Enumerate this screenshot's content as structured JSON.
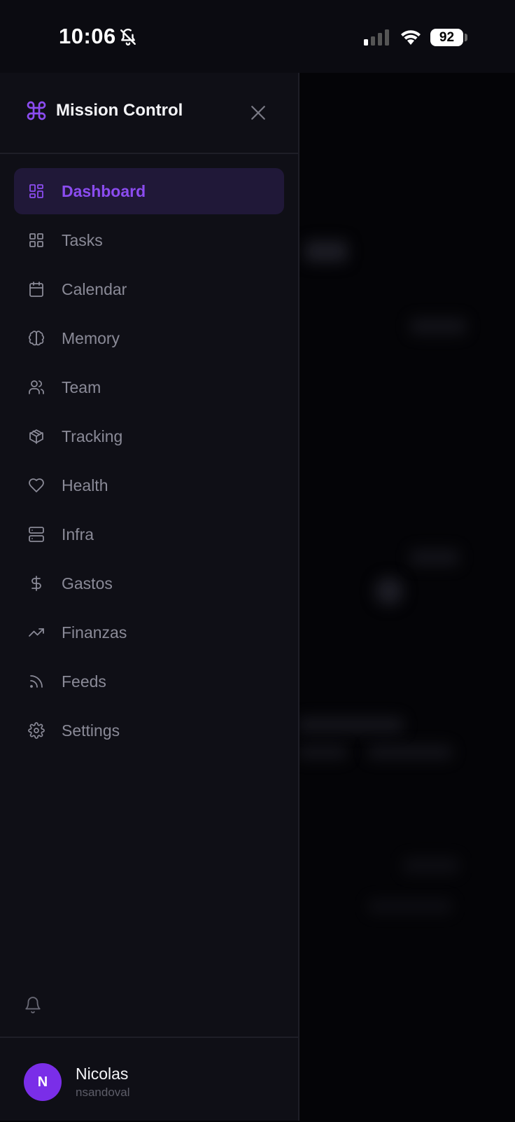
{
  "status_bar": {
    "time": "10:06",
    "battery": "92"
  },
  "sidebar": {
    "title": "Mission Control",
    "items": [
      {
        "label": "Dashboard",
        "icon": "dashboard-icon",
        "active": true
      },
      {
        "label": "Tasks",
        "icon": "grid-icon",
        "active": false
      },
      {
        "label": "Calendar",
        "icon": "calendar-icon",
        "active": false
      },
      {
        "label": "Memory",
        "icon": "brain-icon",
        "active": false
      },
      {
        "label": "Team",
        "icon": "users-icon",
        "active": false
      },
      {
        "label": "Tracking",
        "icon": "package-icon",
        "active": false
      },
      {
        "label": "Health",
        "icon": "heart-icon",
        "active": false
      },
      {
        "label": "Infra",
        "icon": "server-icon",
        "active": false
      },
      {
        "label": "Gastos",
        "icon": "dollar-icon",
        "active": false
      },
      {
        "label": "Finanzas",
        "icon": "trending-up-icon",
        "active": false
      },
      {
        "label": "Feeds",
        "icon": "rss-icon",
        "active": false
      },
      {
        "label": "Settings",
        "icon": "gear-icon",
        "active": false
      }
    ]
  },
  "user": {
    "initial": "N",
    "name": "Nicolas",
    "handle": "nsandoval"
  },
  "colors": {
    "accent": "#8b4cf0",
    "active_bg": "#201838",
    "drawer_bg": "#0f0f16"
  }
}
